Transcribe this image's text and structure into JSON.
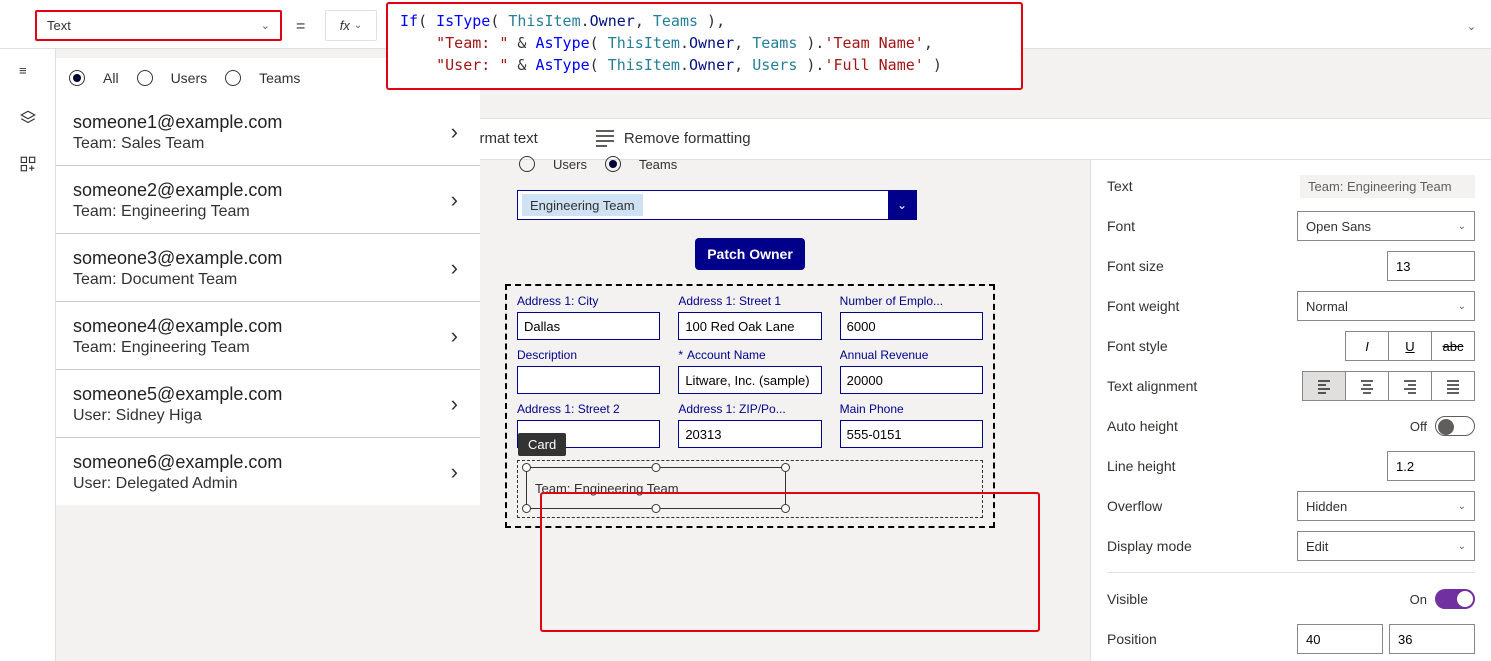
{
  "property_dropdown": {
    "value": "Text"
  },
  "formula_bar": {
    "line1": [
      [
        "kw",
        "If"
      ],
      [
        "p",
        "( "
      ],
      [
        "kw",
        "IsType"
      ],
      [
        "p",
        "( "
      ],
      [
        "id",
        "ThisItem"
      ],
      [
        "p",
        "."
      ],
      [
        "fld",
        "Owner"
      ],
      [
        "p",
        ", "
      ],
      [
        "id",
        "Teams"
      ],
      [
        "p",
        " ),"
      ]
    ],
    "line2": [
      [
        "p",
        "    "
      ],
      [
        "str",
        "\"Team: \""
      ],
      [
        "p",
        " & "
      ],
      [
        "kw",
        "AsType"
      ],
      [
        "p",
        "( "
      ],
      [
        "id",
        "ThisItem"
      ],
      [
        "p",
        "."
      ],
      [
        "fld",
        "Owner"
      ],
      [
        "p",
        ", "
      ],
      [
        "id",
        "Teams"
      ],
      [
        "p",
        " )."
      ],
      [
        "str",
        "'Team Name'"
      ],
      [
        "p",
        ","
      ]
    ],
    "line3": [
      [
        "p",
        "    "
      ],
      [
        "str",
        "\"User: \""
      ],
      [
        "p",
        " & "
      ],
      [
        "kw",
        "AsType"
      ],
      [
        "p",
        "( "
      ],
      [
        "id",
        "ThisItem"
      ],
      [
        "p",
        "."
      ],
      [
        "fld",
        "Owner"
      ],
      [
        "p",
        ", "
      ],
      [
        "id",
        "Users"
      ],
      [
        "p",
        " )."
      ],
      [
        "str",
        "'Full Name'"
      ],
      [
        "p",
        " )"
      ]
    ]
  },
  "format_row": {
    "format": "Format text",
    "remove": "Remove formatting"
  },
  "list": {
    "filter": {
      "all": "All",
      "users": "Users",
      "teams": "Teams",
      "selected": "all"
    },
    "items": [
      {
        "email": "someone1@example.com",
        "sub": "Team: Sales Team"
      },
      {
        "email": "someone2@example.com",
        "sub": "Team: Engineering Team"
      },
      {
        "email": "someone3@example.com",
        "sub": "Team: Document Team"
      },
      {
        "email": "someone4@example.com",
        "sub": "Team: Engineering Team"
      },
      {
        "email": "someone5@example.com",
        "sub": "User: Sidney Higa"
      },
      {
        "email": "someone6@example.com",
        "sub": "User: Delegated Admin"
      }
    ]
  },
  "form": {
    "filter": {
      "users": "Users",
      "teams": "Teams",
      "selected": "teams"
    },
    "combo_value": "Engineering Team",
    "patch_label": "Patch Owner",
    "fields": [
      {
        "label": "Address 1: City",
        "value": "Dallas"
      },
      {
        "label": "Address 1: Street 1",
        "value": "100 Red Oak Lane"
      },
      {
        "label": "Number of Emplo...",
        "value": "6000"
      },
      {
        "label": "Description",
        "value": ""
      },
      {
        "label": "Account Name",
        "value": "Litware, Inc. (sample)",
        "required": true
      },
      {
        "label": "Annual Revenue",
        "value": "20000"
      },
      {
        "label": "Address 1: Street 2",
        "value": ""
      },
      {
        "label": "Address 1: ZIP/Po...",
        "value": "20313"
      },
      {
        "label": "Main Phone",
        "value": "555-0151"
      }
    ],
    "card_tooltip": "Card",
    "selected_text": "Team: Engineering Team"
  },
  "props": {
    "text": {
      "label": "Text",
      "value": "Team: Engineering Team"
    },
    "font": {
      "label": "Font",
      "value": "Open Sans"
    },
    "font_size": {
      "label": "Font size",
      "value": "13"
    },
    "font_weight": {
      "label": "Font weight",
      "value": "Normal"
    },
    "font_style": {
      "label": "Font style"
    },
    "align": {
      "label": "Text alignment"
    },
    "auto_height": {
      "label": "Auto height",
      "state": "Off"
    },
    "line_height": {
      "label": "Line height",
      "value": "1.2"
    },
    "overflow": {
      "label": "Overflow",
      "value": "Hidden"
    },
    "display_mode": {
      "label": "Display mode",
      "value": "Edit"
    },
    "visible": {
      "label": "Visible",
      "state": "On"
    },
    "position": {
      "label": "Position",
      "x": "40",
      "y": "36"
    }
  }
}
